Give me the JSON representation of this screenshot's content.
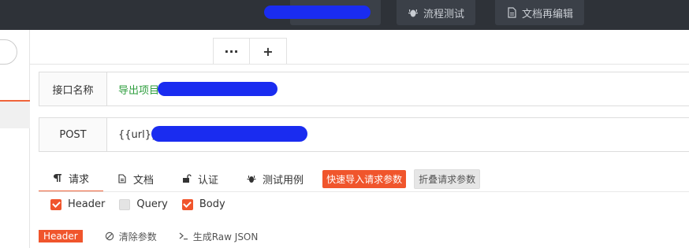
{
  "topbar": {
    "buttons": [
      {
        "label": "流程测试",
        "icon": "bug-icon"
      },
      {
        "label": "文档再编辑",
        "icon": "document-icon"
      }
    ]
  },
  "toolbar": {
    "more_label": "···",
    "add_label": "+"
  },
  "api_name": {
    "label": "接口名称",
    "value": "导出项目"
  },
  "request": {
    "method": "POST",
    "url": "{{url}}rest/..."
  },
  "tabs": [
    {
      "label": "请求",
      "icon": "paragraph-icon"
    },
    {
      "label": "文档",
      "icon": "document-icon"
    },
    {
      "label": "认证",
      "icon": "lock-icon"
    },
    {
      "label": "测试用例",
      "icon": "bug-icon"
    }
  ],
  "quick_import_label": "快速导入请求参数",
  "collapse_label": "折叠请求参数",
  "checkboxes": [
    {
      "label": "Header",
      "checked": true
    },
    {
      "label": "Query",
      "checked": false
    },
    {
      "label": "Body",
      "checked": true
    }
  ],
  "bottom": {
    "tag": "Header",
    "clear_label": "清除参数",
    "raw_label": "生成Raw JSON"
  },
  "colors": {
    "accent": "#f0552c",
    "topbar": "#2e3238",
    "name_text": "#2e9e3e"
  }
}
